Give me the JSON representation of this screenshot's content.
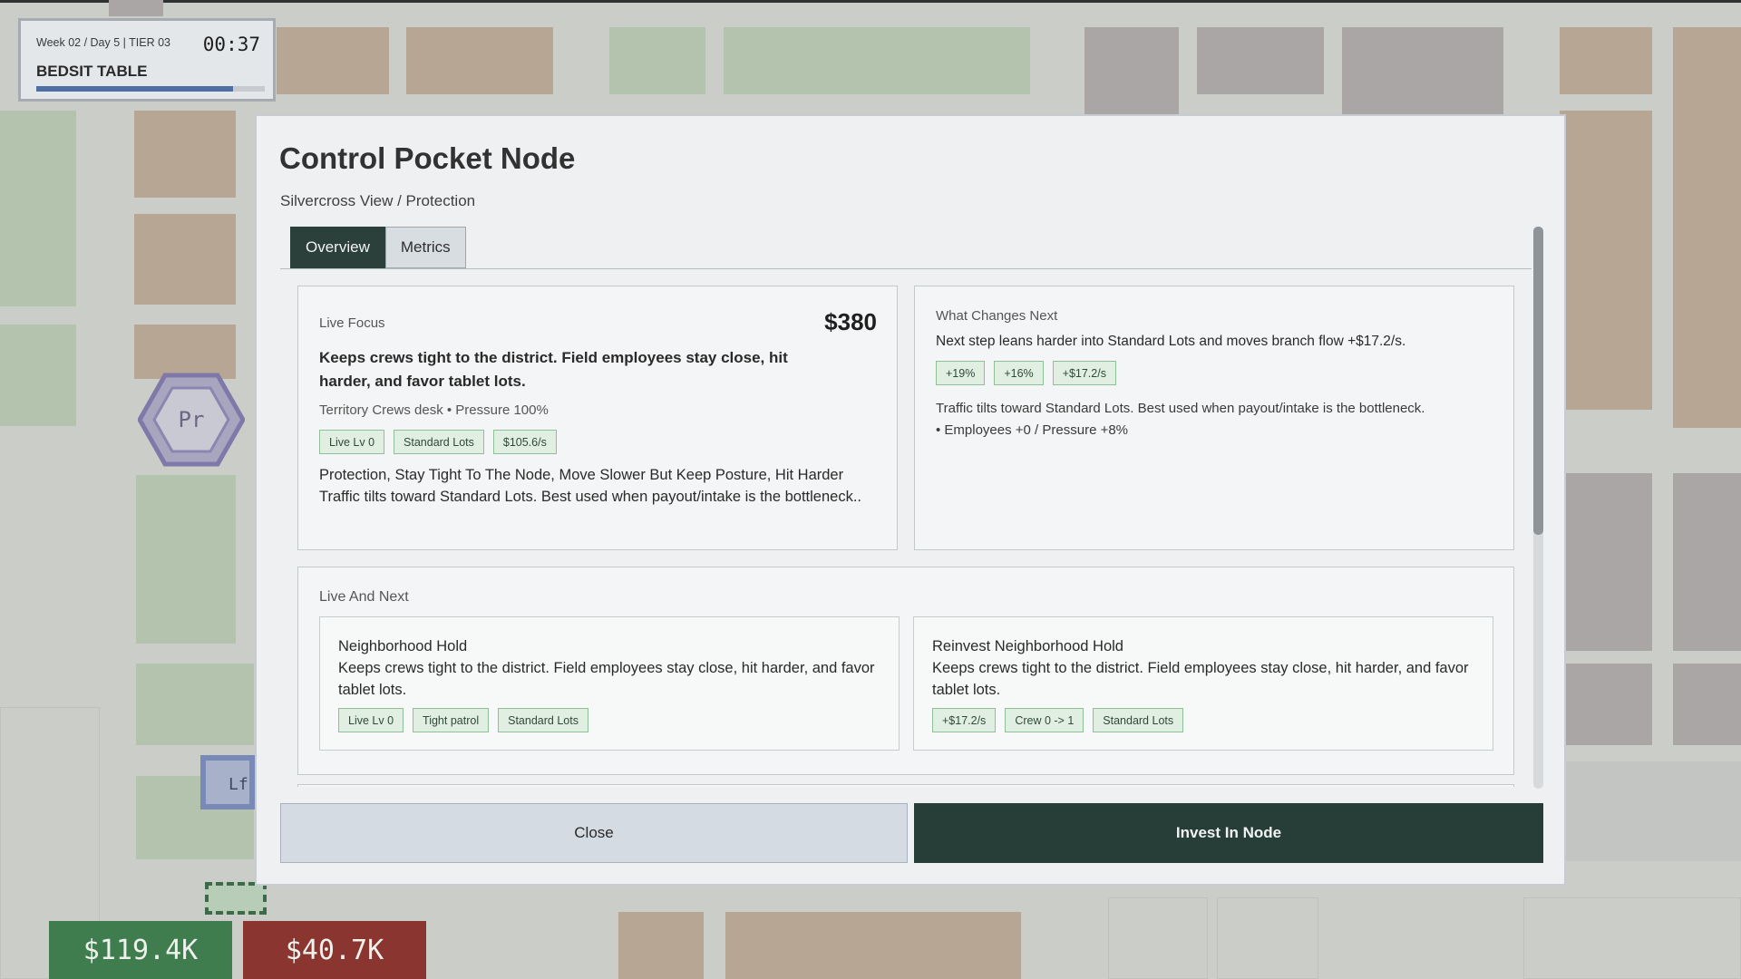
{
  "hud": {
    "week_info": "Week 02 / Day 5  |  TIER 03",
    "timer": "00:37",
    "title": "BEDSIT TABLE",
    "progress_fraction": 0.86
  },
  "map": {
    "node_pr_label": "Pr",
    "node_lf_label": "Lf"
  },
  "bank": {
    "cash": "$119.4K",
    "debt": "$40.7K"
  },
  "modal": {
    "title": "Control Pocket Node",
    "subtitle": "Silvercross View / Protection",
    "tabs": [
      {
        "label": "Overview",
        "active": true
      },
      {
        "label": "Metrics",
        "active": false
      }
    ],
    "live_focus": {
      "label": "Live Focus",
      "price": "$380",
      "headline": "Keeps crews tight to the district. Field employees stay close, hit harder, and favor tablet lots.",
      "meta": "Territory Crews desk  •  Pressure 100%",
      "chips": [
        "Live Lv 0",
        "Standard Lots",
        "$105.6/s"
      ],
      "description": "Protection, Stay Tight To The Node, Move Slower But Keep Posture, Hit Harder Traffic tilts toward Standard Lots. Best used when payout/intake is the bottleneck.."
    },
    "what_next": {
      "label": "What Changes Next",
      "headline": "Next step leans harder into Standard Lots and moves branch flow +$17.2/s.",
      "chips": [
        "+19%",
        "+16%",
        "+$17.2/s"
      ],
      "note": "Traffic tilts toward Standard Lots. Best used when payout/intake is the bottleneck.",
      "bullet": "• Employees +0 / Pressure +8%"
    },
    "live_and_next": {
      "label": "Live And Next",
      "cards": [
        {
          "title": "Neighborhood Hold",
          "body": "Keeps crews tight to the district. Field employees stay close, hit harder, and favor tablet lots.",
          "chips": [
            "Live Lv 0",
            "Tight patrol",
            "Standard Lots"
          ]
        },
        {
          "title": "Reinvest Neighborhood Hold",
          "body": "Keeps crews tight to the district. Field employees stay close, hit harder, and favor tablet lots.",
          "chips": [
            "+$17.2/s",
            "Crew 0 -> 1",
            "Standard Lots"
          ]
        }
      ]
    },
    "buttons": {
      "close": "Close",
      "invest": "Invest In Node"
    }
  },
  "colors": {
    "accent_dark": "#273d37",
    "cash_green": "#3f7c4e",
    "debt_red": "#8a3530",
    "chip_bg": "#e1efe2",
    "hud_progress": "#4d6fa6"
  }
}
